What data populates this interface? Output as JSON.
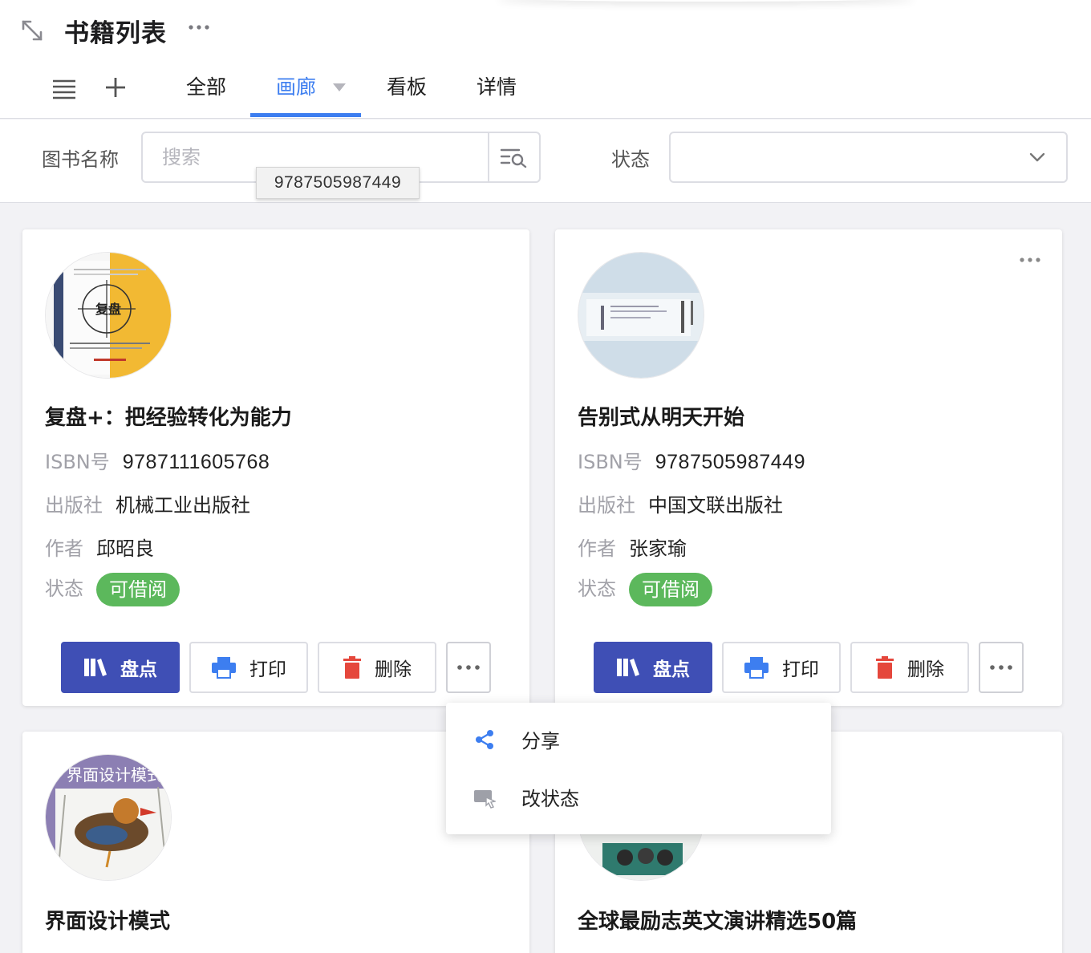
{
  "header": {
    "title": "书籍列表",
    "tabs": [
      {
        "label": "全部"
      },
      {
        "label": "画廊"
      },
      {
        "label": "看板"
      },
      {
        "label": "详情"
      }
    ]
  },
  "filters": {
    "book_name_label": "图书名称",
    "search_placeholder": "搜索",
    "status_label": "状态",
    "status_value": "",
    "tooltip": "9787505987449"
  },
  "cards": [
    {
      "title": "复盘+：把经验转化为能力",
      "isbn_label": "ISBN号",
      "isbn": "9787111605768",
      "publisher_label": "出版社",
      "publisher": "机械工业出版社",
      "author_label": "作者",
      "author": "邱昭良",
      "status_label": "状态",
      "status": "可借阅",
      "actions": {
        "inventory": "盘点",
        "print": "打印",
        "delete": "删除"
      }
    },
    {
      "title": "告别式从明天开始",
      "isbn_label": "ISBN号",
      "isbn": "9787505987449",
      "publisher_label": "出版社",
      "publisher": "中国文联出版社",
      "author_label": "作者",
      "author": "张家瑜",
      "status_label": "状态",
      "status": "可借阅",
      "actions": {
        "inventory": "盘点",
        "print": "打印",
        "delete": "删除"
      }
    },
    {
      "title": "界面设计模式",
      "cover_text": "界面设计模式"
    },
    {
      "title": "全球最励志英文演讲精选50篇"
    }
  ],
  "cover_texts": {
    "card1": "复盘"
  },
  "dropdown_menu": {
    "items": [
      {
        "label": "分享"
      },
      {
        "label": "改状态"
      }
    ]
  },
  "colors": {
    "accent": "#3d7ef0",
    "primary_button": "#3f4fb5",
    "status_available": "#5cb85c",
    "delete_icon": "#e5473c",
    "print_icon": "#3d7ef0"
  }
}
